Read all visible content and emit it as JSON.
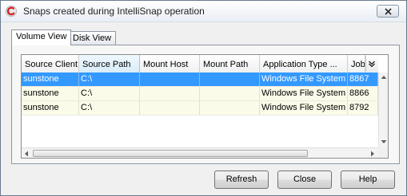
{
  "window": {
    "title": "Snaps created during IntelliSnap operation"
  },
  "tabs": [
    {
      "label": "Volume View",
      "active": true
    },
    {
      "label": "Disk View",
      "active": false
    }
  ],
  "table": {
    "columns": [
      "Source Client",
      "Source Path",
      "Mount Host",
      "Mount Path",
      "Application Type ...",
      "Job"
    ],
    "sorted_column": "Source Path",
    "rows": [
      {
        "source_client": "sunstone",
        "source_path": "C:\\",
        "mount_host": "",
        "mount_path": "",
        "application_type": "Windows File System",
        "job": "8867",
        "selected": true
      },
      {
        "source_client": "sunstone",
        "source_path": "C:\\",
        "mount_host": "",
        "mount_path": "",
        "application_type": "Windows File System",
        "job": "8866",
        "selected": false
      },
      {
        "source_client": "sunstone",
        "source_path": "C:\\",
        "mount_host": "",
        "mount_path": "",
        "application_type": "Windows File System",
        "job": "8792",
        "selected": false
      }
    ]
  },
  "buttons": {
    "refresh": "Refresh",
    "close": "Close",
    "help": "Help"
  },
  "icons": {
    "app": "commvault-app-icon",
    "window_close": "close-icon",
    "column_menu": "chevron-down-icon"
  },
  "colors": {
    "selection": "#3399ff",
    "alt_row": "#fbfbe9",
    "sorted_header": "#d8ecf9"
  }
}
